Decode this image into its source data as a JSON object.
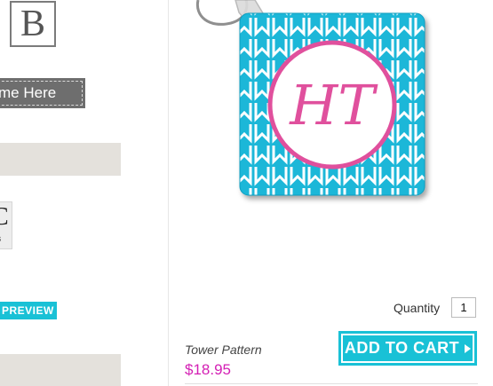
{
  "sidebar": {
    "logo_letter": "B",
    "name_tag_text": "me Here",
    "font_chip_big": "C",
    "font_chip_small": "rs",
    "preview_label": "PREVIEW"
  },
  "product": {
    "monogram": "HT",
    "name": "Tower Pattern",
    "price": "$18.95",
    "quantity_label": "Quantity",
    "quantity_value": "1",
    "add_to_cart_label": "ADD TO CART"
  },
  "colors": {
    "accent": "#19c1d6",
    "price": "#d41fb4",
    "monogram_pink": "#e0509d"
  }
}
